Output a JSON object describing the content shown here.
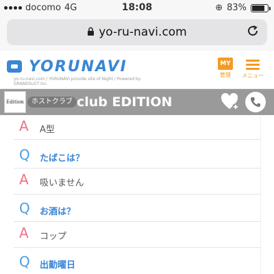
{
  "status_bar": {
    "carrier": "docomo",
    "network": "4G",
    "time": "18:08",
    "battery": "83%",
    "battery_level": 0.83
  },
  "browser": {
    "url": "yo-ru-navi.com"
  },
  "header": {
    "logo_text": "YORUNAVI",
    "tagline": "yo-ru-navi.com / YORUNAVI provide site of Night / Powered by GRANDSLOT Inc.",
    "my_label": "MY",
    "manage_label": "管理",
    "menu_label": "メニュー",
    "accent_color": "#f29b24",
    "brand_color": "#3a86d4"
  },
  "club": {
    "logo_text": "Edition",
    "category": "ホストクラブ",
    "name": "club EDITION"
  },
  "qa": [
    {
      "type": "A",
      "text": "A型"
    },
    {
      "type": "Q",
      "text": "たばこは？"
    },
    {
      "type": "A",
      "text": "吸いません"
    },
    {
      "type": "Q",
      "text": "お酒は？"
    },
    {
      "type": "A",
      "text": "コップ"
    },
    {
      "type": "Q",
      "text": "出勤曜日"
    }
  ]
}
